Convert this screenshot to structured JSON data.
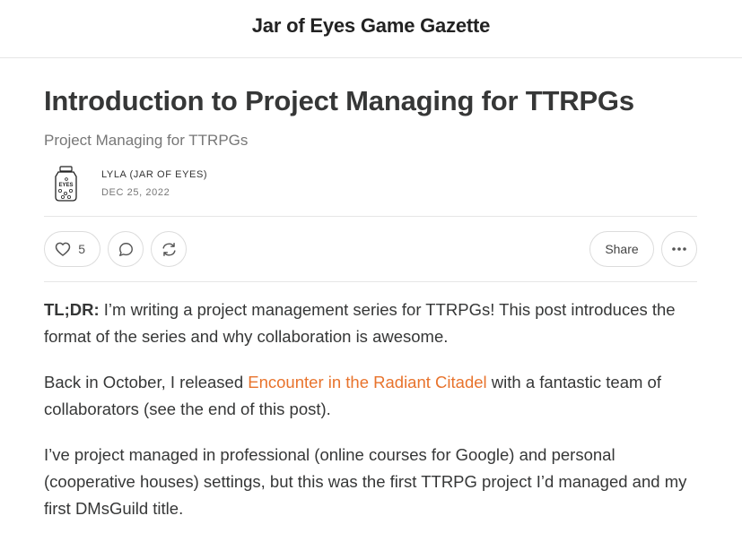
{
  "header": {
    "publication_title": "Jar of Eyes Game Gazette"
  },
  "post": {
    "title": "Introduction to Project Managing for TTRPGs",
    "subtitle": "Project Managing for TTRPGs",
    "author": "LYLA (JAR OF EYES)",
    "date": "DEC 25, 2022",
    "avatar_text": "EYES"
  },
  "actions": {
    "like_count": "5",
    "share_label": "Share",
    "icons": [
      "heart-icon",
      "comment-icon",
      "restack-icon",
      "ellipsis-icon"
    ]
  },
  "body": {
    "p1_lead": "TL;DR:",
    "p1_text": " I’m writing a project management series for TTRPGs! This post introduces the format of the series and why collaboration is awesome.",
    "p2_before": "Back in October, I released ",
    "p2_link": "Encounter in the Radiant Citadel",
    "p2_after": " with a fantastic team of collaborators (see the end of this post).",
    "p3_text": "I’ve project managed in professional (online courses for Google) and personal (cooperative houses) settings, but this was the first TTRPG project I’d managed and my first DMsGuild title."
  },
  "colors": {
    "accent": "#e8732c",
    "border": "#dcdcdc",
    "text": "#363737"
  }
}
